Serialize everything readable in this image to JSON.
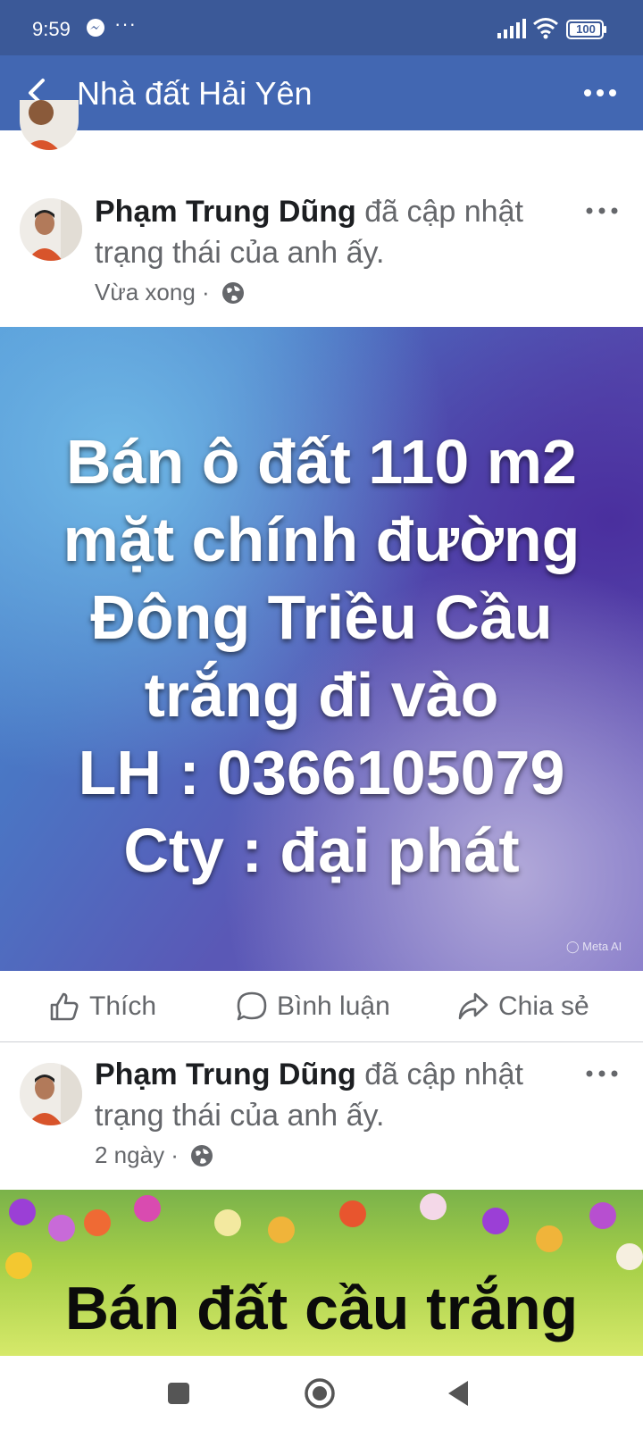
{
  "status_bar": {
    "time": "9:59",
    "more_dots": "···",
    "battery": "100",
    "icons": [
      "messenger-icon",
      "signal-icon",
      "wifi-icon",
      "battery-icon"
    ]
  },
  "app_bar": {
    "title": "Nhà đất Hải Yên",
    "icons": [
      "back-arrow-icon",
      "more-horizontal-icon"
    ]
  },
  "posts": [
    {
      "author": "Phạm Trung Dũng",
      "action": "đã cập nhật trạng thái của anh ấy.",
      "time": "Vừa xong",
      "separator": " · ",
      "image_text_lines": [
        "Bán ô đất 110 m2",
        "mặt chính đường",
        "Đông Triều Cầu",
        "trắng đi vào",
        "LH : 0366105079",
        "Cty : đại phát"
      ],
      "watermark": "◯ Meta AI"
    },
    {
      "author": "Phạm Trung Dũng",
      "action": "đã cập nhật trạng thái của anh ấy.",
      "time": "2 ngày",
      "separator": " · ",
      "image_text": "Bán đất cầu trắng"
    }
  ],
  "actions": {
    "like": "Thích",
    "comment": "Bình luận",
    "share": "Chia sẻ"
  },
  "colors": {
    "status_bar": "#3b5998",
    "app_bar": "#4267b2",
    "secondary_text": "#65676b"
  }
}
